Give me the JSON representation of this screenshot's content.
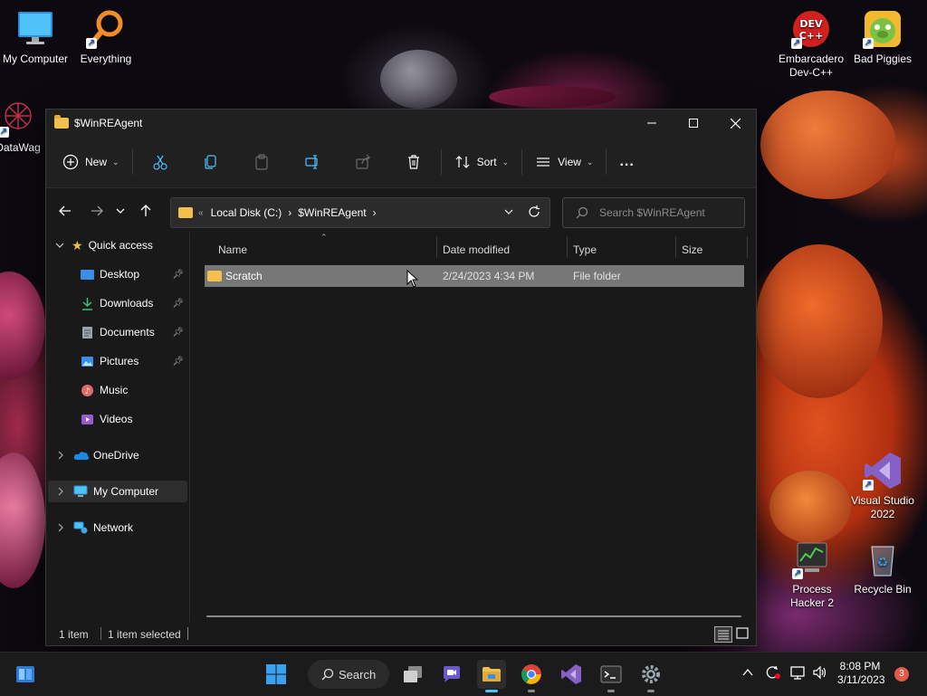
{
  "desktop": {
    "icons_left": [
      {
        "label": "My Computer",
        "icon": "monitor-icon"
      },
      {
        "label": "Everything",
        "icon": "magnifier-icon"
      },
      {
        "label": "DataWag",
        "icon": "datawag-icon"
      }
    ],
    "icons_right": [
      {
        "label_line1": "Embarcadero",
        "label_line2": "Dev-C++",
        "icon": "devcpp-icon",
        "badge": "DEV C++"
      },
      {
        "label_line1": "Bad Piggies",
        "label_line2": "",
        "icon": "bad-piggies-icon"
      },
      {
        "label_line1": "Visual Studio",
        "label_line2": "2022",
        "icon": "visual-studio-icon"
      },
      {
        "label_line1": "Process",
        "label_line2": "Hacker 2",
        "icon": "process-hacker-icon"
      },
      {
        "label_line1": "Recycle Bin",
        "label_line2": "",
        "icon": "recycle-bin-icon"
      }
    ]
  },
  "window": {
    "title": "$WinREAgent",
    "controls": {
      "minimize": "minimize",
      "maximize": "maximize",
      "close": "close"
    }
  },
  "toolbar": {
    "new_label": "New",
    "sort_label": "Sort",
    "view_label": "View",
    "more_label": "..."
  },
  "address": {
    "overflow": "«",
    "crumbs": [
      "Local Disk (C:)",
      "$WinREAgent"
    ],
    "search_placeholder": "Search $WinREAgent"
  },
  "nav": {
    "quick_access": "Quick access",
    "items": [
      {
        "label": "Desktop",
        "pinned": true,
        "icon": "desktop-icon",
        "color": "#3a8ee6"
      },
      {
        "label": "Downloads",
        "pinned": true,
        "icon": "download-icon",
        "color": "#3fbf7f"
      },
      {
        "label": "Documents",
        "pinned": true,
        "icon": "documents-icon",
        "color": "#9aa4b0"
      },
      {
        "label": "Pictures",
        "pinned": true,
        "icon": "pictures-icon",
        "color": "#3a8ee6"
      },
      {
        "label": "Music",
        "pinned": false,
        "icon": "music-icon",
        "color": "#e06b6b"
      },
      {
        "label": "Videos",
        "pinned": false,
        "icon": "videos-icon",
        "color": "#9b59d0"
      }
    ],
    "onedrive": "OneDrive",
    "mycomputer": "My Computer",
    "network": "Network"
  },
  "columns": {
    "name": "Name",
    "date": "Date modified",
    "type": "Type",
    "size": "Size"
  },
  "files": [
    {
      "name": "Scratch",
      "date": "2/24/2023 4:34 PM",
      "type": "File folder",
      "size": ""
    }
  ],
  "status": {
    "count": "1 item",
    "selected": "1 item selected"
  },
  "taskbar": {
    "search_label": "Search",
    "time": "8:08 PM",
    "date": "3/11/2023",
    "notification_count": "3"
  },
  "colors": {
    "accent": "#4cc2ff",
    "folder": "#f2c04d",
    "selection": "#777777"
  }
}
